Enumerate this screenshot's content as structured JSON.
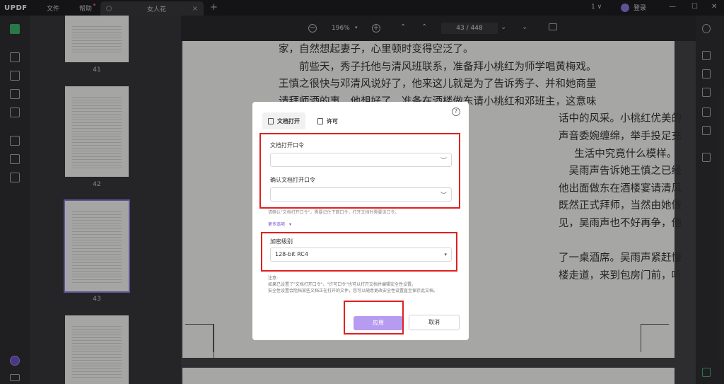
{
  "titlebar": {
    "logo": "UPDF",
    "menu": [
      "文件",
      "帮助"
    ],
    "tab_title": "女人花",
    "tab_close": "×",
    "add_tab": "+",
    "window_count": "1 ∨",
    "login": "登录",
    "controls": [
      "—",
      "☐",
      "✕"
    ]
  },
  "thumbnails": [
    {
      "label": "41"
    },
    {
      "label": "42"
    },
    {
      "label": "43"
    }
  ],
  "toolbar": {
    "zoom_minus": "−",
    "zoom": "196%",
    "zoom_caret": "▾",
    "zoom_plus": "+",
    "page_display": "43 / 448",
    "up_single": "⌃",
    "up_double": "⌃",
    "down_double": "⌄",
    "down_single": "⌄"
  },
  "document": {
    "lines": [
      "家，自然想起妻子，心里顿时变得空泛了。",
      "　　前些天，秀子托他与清风班联系，准备拜小桃红为师学唱黄梅戏。",
      "王慎之很快与邓清风说好了，他来这儿就是为了告诉秀子、并和她商量",
      "请拜师酒的事。他想好了，准备在酒楼做东请小桃红和邓班主，这意味",
      "　　　　　　　　　　　　　　　　　　　　　　　　　　　　　　　　　　　　　　　　　　　　　　　　　　　　　　　　　　　　　　　　　　　　　　　话中的风采。小桃红优美的",
      "　　　　　　　　　　　　　　　　　　　　　　　　　　　　　　　　　　　　　　　　　　　　　　　　　　　　　　　　　　　　　　　　　　　　　　　声音委婉缠绵，举手投足充",
      "　　　　　　　　　　　　　　　　　　　　　　　　　　　　　　　　　　　　　　　　　　　　　　　　　　　　　　　　　　　　　　　　　　　　　　　生活中究竟什么模样。",
      "　　　　　　　　　　　　　　　　　　　　　　　　　　　　　　　　　　　　　　　　　　　　　　　　　　　　　　　　　　　　　　　　　　　　　　　　吴雨声告诉她王慎之已经",
      "　　　　　　　　　　　　　　　　　　　　　　　　　　　　　　　　　　　　　　　　　　　　　　　　　　　　　　　　　　　　　　　　　　　　　　　他出面做东在酒楼宴请清风",
      "　　　　　　　　　　　　　　　　　　　　　　　　　　　　　　　　　　　　　　　　　　　　　　　　　　　　　　　　　　　　　　　　　　　　　　　既然正式拜师，当然由她做",
      "　　　　　　　　　　　　　　　　　　　　　　　　　　　　　　　　　　　　　　　　　　　　　　　　　　　　　　　　　　　　　　　　　　　　　　　见，吴雨声也不好再争，他",
      "",
      "　　　　　　　　　　　　　　　　　　　　　　　　　　　　　　　　　　　　　　　　　　　　　　　　　　　　　　　　　　　　　　　　　　　　　　　了一桌酒席。吴雨声紧赶慢",
      "　　　　　　　　　　　　　　　　　　　　　　　　　　　　　　　　　　　　　　　　　　　　　　　　　　　　　　　　　　　　　　　　　　　　　　　楼走道，来到包房门前，听"
    ]
  },
  "dialog": {
    "help": "?",
    "tab_open": "文档打开",
    "tab_permission": "许可",
    "open_password_label": "文档打开口令",
    "confirm_password_label": "确认文档打开口令",
    "eye": "👁",
    "hint": "请确认\"文档打开口令\"，需要记住下面口令，打开文档时需要该口令。",
    "more_options": "更多选项　▾",
    "encryption_label": "加密级别",
    "encryption_value": "128-bit RC4",
    "caret": "▾",
    "note": "注意:\n如果已设置了\"文档打开口令\"、\"许可口令\"也可以打开文档并编辑安全性设置。\n安全性设置会阻挡某些文档正在打开的文件，您可以随意更改安全性设置直至保存此文档。",
    "apply": "应用",
    "cancel": "取消"
  },
  "colors": {
    "accent": "#b69bf0",
    "highlight": "#e02020",
    "active_tool": "#3fb36a"
  }
}
